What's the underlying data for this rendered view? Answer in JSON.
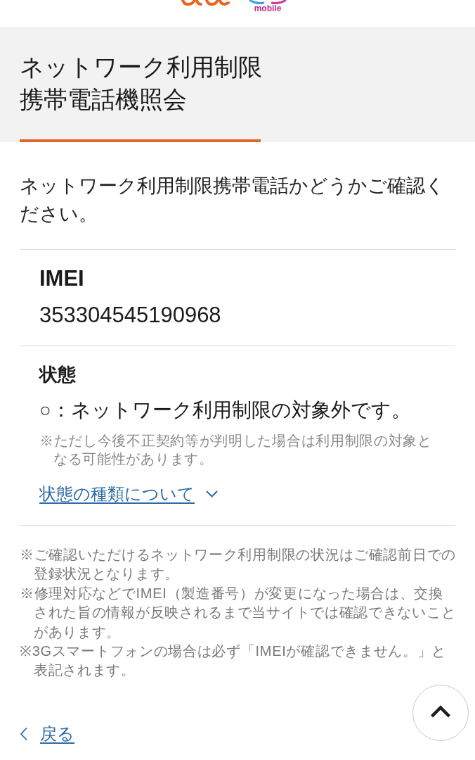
{
  "logo": {
    "text": "mobile"
  },
  "header": {
    "title_lines": [
      "ネットワーク利用制限",
      "携帯電話機照会"
    ]
  },
  "intro": "ネットワーク利用制限携帯電話かどうかご確認ください。",
  "imei": {
    "label": "IMEI",
    "value": "353304545190968"
  },
  "status": {
    "label": "状態",
    "result": "○：ネットワーク利用制限の対象外です。",
    "note": "※ただし今後不正契約等が判明した場合は利用制限の対象となる可能性があります。",
    "types_link": {
      "label": "状態の種類について",
      "expanded": false
    }
  },
  "notes": [
    "※ご確認いただけるネットワーク利用制限の状況はご確認前日での登録状況となります。",
    "※修理対応などでIMEI（製造番号）が変更になった場合は、交換された旨の情報が反映されるまで当サイトでは確認できないことがあります。",
    "※3Gスマートフォンの場合は必ず「IMEIが確認できません。」と表記されます。"
  ],
  "back_link": {
    "label": "戻る"
  }
}
